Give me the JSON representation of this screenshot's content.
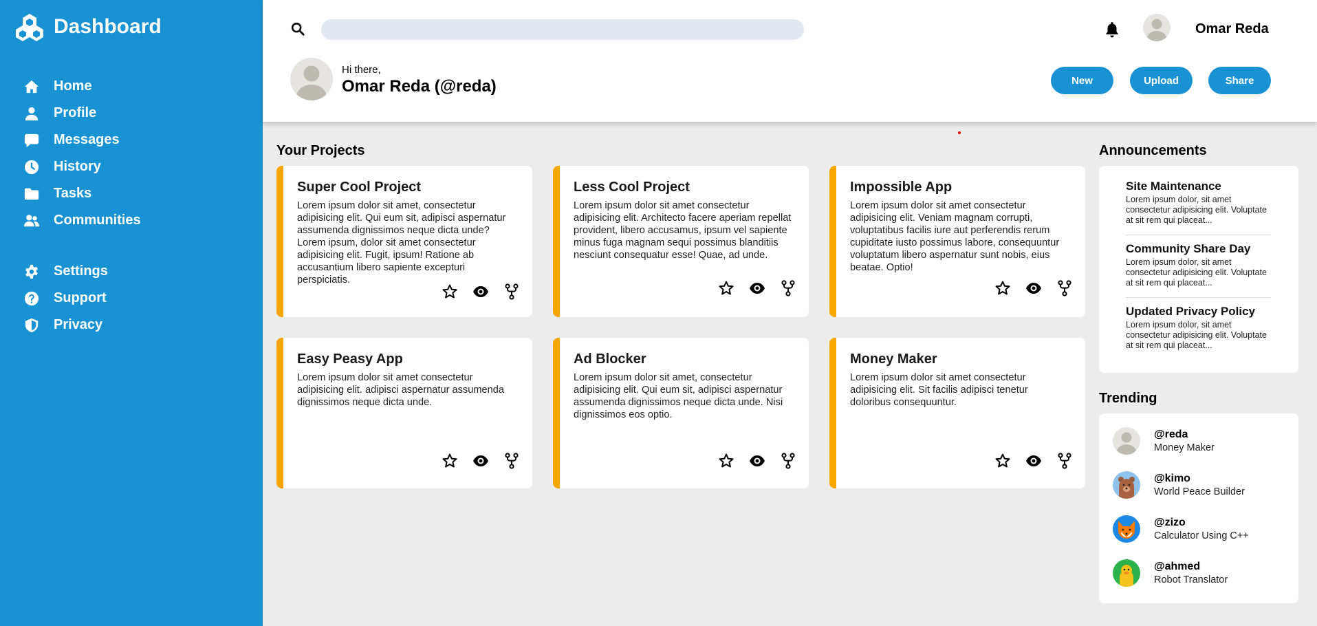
{
  "sidebar": {
    "brand": "Dashboard",
    "items": [
      {
        "label": "Home",
        "icon": "home-icon"
      },
      {
        "label": "Profile",
        "icon": "user-icon"
      },
      {
        "label": "Messages",
        "icon": "chat-icon"
      },
      {
        "label": "History",
        "icon": "clock-icon"
      },
      {
        "label": "Tasks",
        "icon": "folder-icon"
      },
      {
        "label": "Communities",
        "icon": "users-icon"
      }
    ],
    "items2": [
      {
        "label": "Settings",
        "icon": "gear-icon"
      },
      {
        "label": "Support",
        "icon": "help-icon"
      },
      {
        "label": "Privacy",
        "icon": "shield-icon"
      }
    ]
  },
  "header": {
    "search_placeholder": "",
    "user_name": "Omar Reda",
    "greeting": "Hi there,",
    "handle": "Omar Reda (@reda)",
    "buttons": {
      "new": "New",
      "upload": "Upload",
      "share": "Share"
    }
  },
  "projects": {
    "title": "Your Projects",
    "items": [
      {
        "title": "Super Cool Project",
        "desc": "Lorem ipsum dolor sit amet, consectetur adipisicing elit. Qui eum sit, adipisci aspernatur assumenda dignissimos neque dicta unde? Lorem ipsum, dolor sit amet consectetur adipisicing elit. Fugit, ipsum! Ratione ab accusantium libero sapiente excepturi perspiciatis."
      },
      {
        "title": "Less Cool Project",
        "desc": "Lorem ipsum dolor sit amet consectetur adipisicing elit. Architecto facere aperiam repellat provident, libero accusamus, ipsum vel sapiente minus fuga magnam sequi possimus blanditiis nesciunt consequatur esse! Quae, ad unde."
      },
      {
        "title": "Impossible App",
        "desc": "Lorem ipsum dolor sit amet consectetur adipisicing elit. Veniam magnam corrupti, voluptatibus facilis iure aut perferendis rerum cupiditate iusto possimus labore, consequuntur voluptatum libero aspernatur sunt nobis, eius beatae. Optio!"
      },
      {
        "title": "Easy Peasy App",
        "desc": "Lorem ipsum dolor sit amet consectetur adipisicing elit. adipisci aspernatur assumenda dignissimos neque dicta unde."
      },
      {
        "title": "Ad Blocker",
        "desc": "Lorem ipsum dolor sit amet, consectetur adipisicing elit. Qui eum sit, adipisci aspernatur assumenda dignissimos neque dicta unde. Nisi dignissimos eos optio."
      },
      {
        "title": "Money Maker",
        "desc": "Lorem ipsum dolor sit amet consectetur adipisicing elit. Sit facilis adipisci tenetur doloribus consequuntur."
      }
    ]
  },
  "announcements": {
    "title": "Announcements",
    "items": [
      {
        "title": "Site Maintenance",
        "desc": "Lorem ipsum dolor, sit amet consectetur adipisicing elit. Voluptate at sit rem qui placeat..."
      },
      {
        "title": "Community Share Day",
        "desc": "Lorem ipsum dolor, sit amet consectetur adipisicing elit. Voluptate at sit rem qui placeat..."
      },
      {
        "title": "Updated Privacy Policy",
        "desc": "Lorem ipsum dolor, sit amet consectetur adipisicing elit. Voluptate at sit rem qui placeat..."
      }
    ]
  },
  "trending": {
    "title": "Trending",
    "items": [
      {
        "handle": "@reda",
        "project": "Money Maker"
      },
      {
        "handle": "@kimo",
        "project": "World Peace Builder"
      },
      {
        "handle": "@zizo",
        "project": "Calculator Using C++"
      },
      {
        "handle": "@ahmed",
        "project": "Robot Translator"
      }
    ]
  },
  "colors": {
    "primary": "#1992d4",
    "accent": "#f7a600",
    "background": "#ececec",
    "search_bg": "#e2e8f0"
  }
}
